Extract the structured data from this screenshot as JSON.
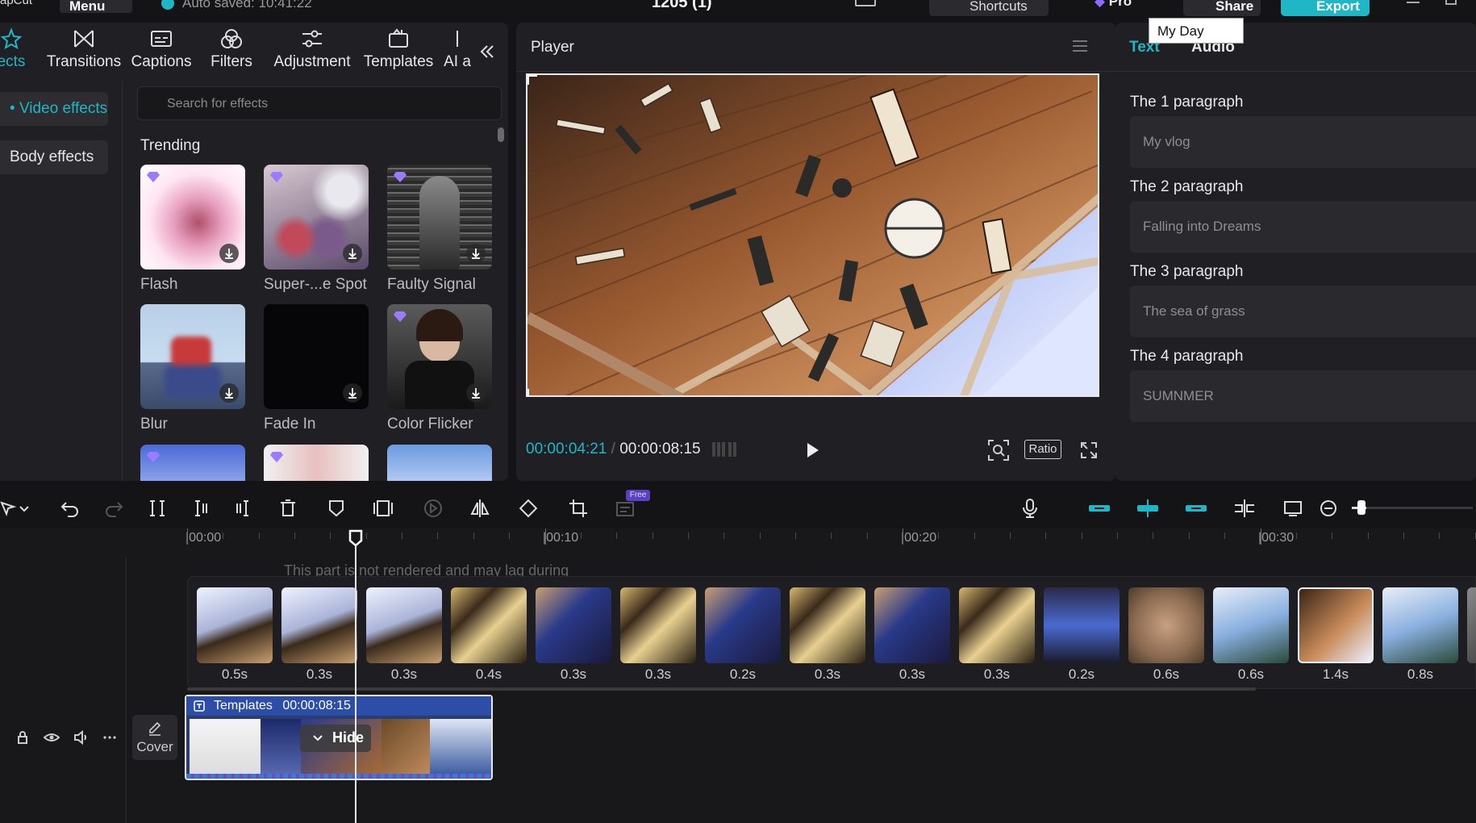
{
  "topbar": {
    "menu_label": "Menu",
    "autosave_text": "Auto saved: 10:41:22",
    "project_title": "1205 (1)",
    "shortcuts_label": "Shortcuts",
    "pro_label": "Pro",
    "share_label": "Share",
    "export_label": "Export",
    "tooltip": "My Day"
  },
  "tool_tabs": [
    {
      "label": "ects",
      "icon": "effects-icon",
      "active": true
    },
    {
      "label": "Transitions",
      "icon": "transitions-icon"
    },
    {
      "label": "Captions",
      "icon": "captions-icon"
    },
    {
      "label": "Filters",
      "icon": "filters-icon"
    },
    {
      "label": "Adjustment",
      "icon": "adjustment-icon"
    },
    {
      "label": "Templates",
      "icon": "templates-icon"
    },
    {
      "label": "AI a",
      "icon": "ai-icon"
    }
  ],
  "sidebar": {
    "items": [
      {
        "label": "Video effects",
        "active": true
      },
      {
        "label": "Body effects"
      }
    ]
  },
  "effects": {
    "search_placeholder": "Search for effects",
    "section_title": "Trending",
    "items": [
      {
        "name": "Flash"
      },
      {
        "name": "Super-...e Spot"
      },
      {
        "name": "Faulty Signal"
      },
      {
        "name": "Blur"
      },
      {
        "name": "Fade In"
      },
      {
        "name": "Color Flicker"
      }
    ]
  },
  "player": {
    "title": "Player",
    "current_time": "00:00:04:21",
    "separator": "/",
    "total_time": "00:00:08:15",
    "ratio_label": "Ratio"
  },
  "right_panel": {
    "tabs": [
      "Text",
      "Audio"
    ],
    "paragraphs": [
      {
        "label": "The 1 paragraph",
        "value": "My vlog"
      },
      {
        "label": "The 2 paragraph",
        "value": "Falling into Dreams"
      },
      {
        "label": "The 3 paragraph",
        "value": "The sea of grass"
      },
      {
        "label": "The 4 paragraph",
        "value": "SUMNMER"
      }
    ]
  },
  "toolbar": {
    "free_badge": "Free"
  },
  "timeline": {
    "ruler": [
      "|00:00",
      "|00:10",
      "|00:20",
      "|00:30"
    ],
    "warning": "This part is not rendered and may lag during preview.",
    "clips": [
      "0.5s",
      "0.3s",
      "0.3s",
      "0.4s",
      "0.3s",
      "0.3s",
      "0.2s",
      "0.3s",
      "0.3s",
      "0.3s",
      "0.2s",
      "0.6s",
      "0.6s",
      "1.4s",
      "0.8s"
    ],
    "template_label": "Templates",
    "template_duration": "00:00:08:15",
    "hide_label": "Hide",
    "cover_label": "Cover"
  },
  "colors": {
    "accent": "#1fb7c6",
    "panel": "#202024",
    "background": "#141416"
  }
}
